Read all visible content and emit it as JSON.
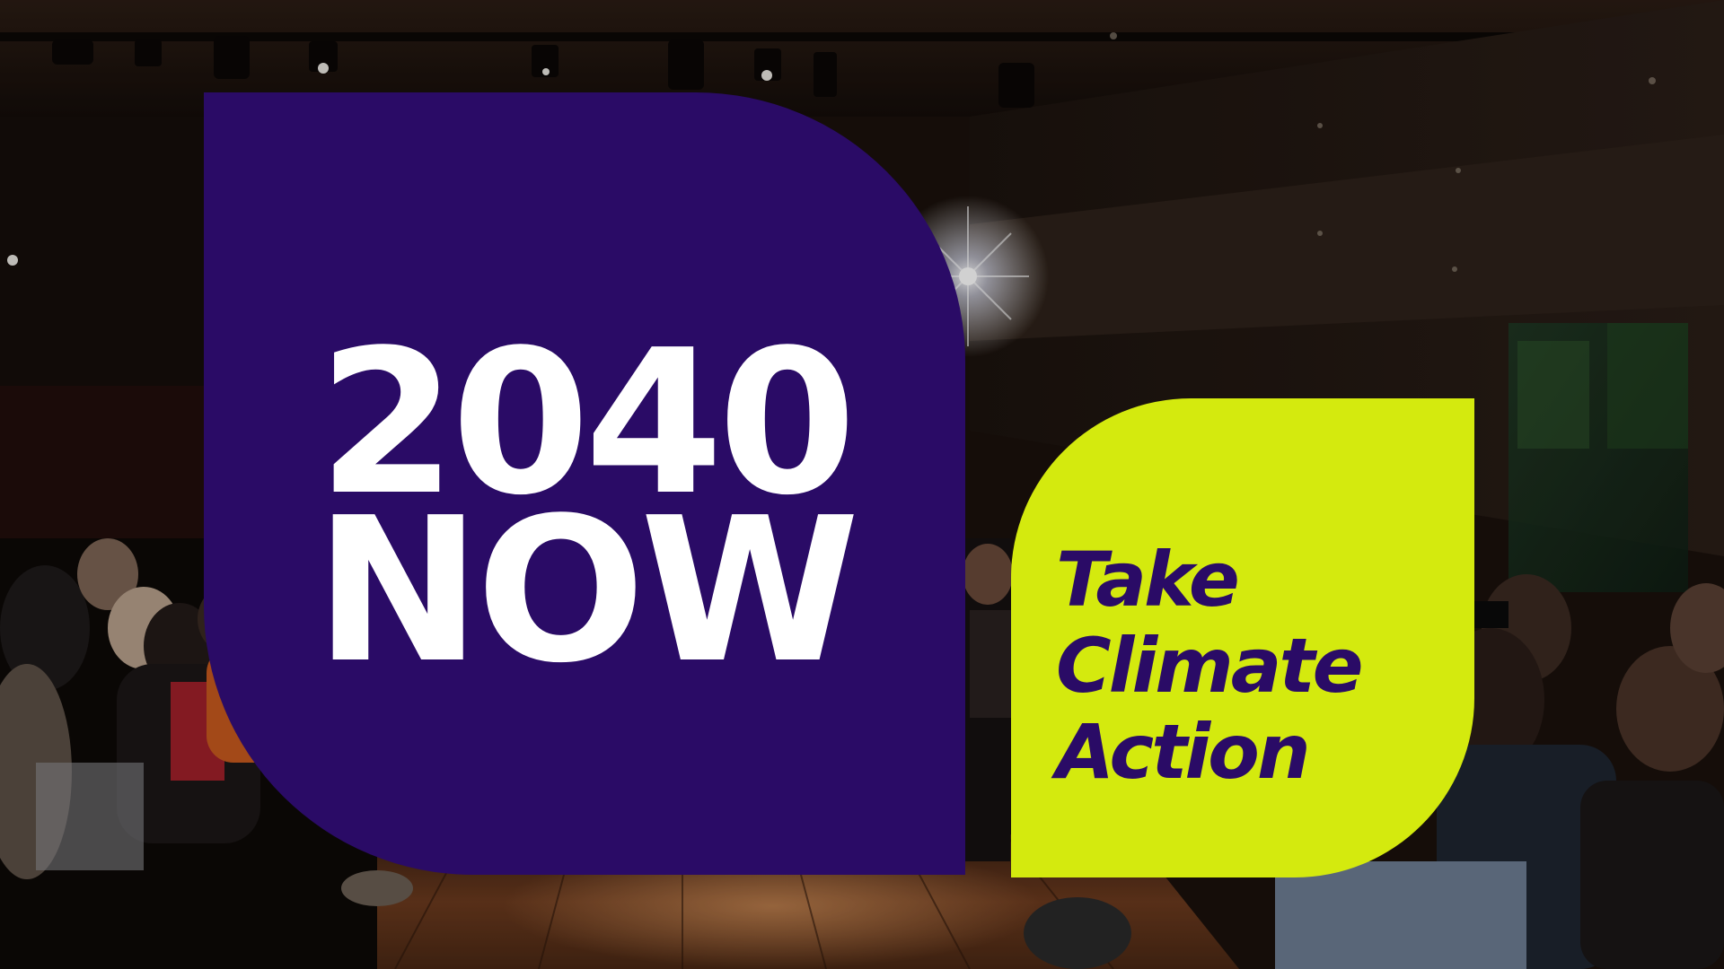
{
  "background": {
    "description_icon": "auditorium-photo"
  },
  "logo": {
    "line1": "2040",
    "line2": "NOW"
  },
  "tagline": {
    "line1": "Take",
    "line2": "Climate",
    "line3": "Action"
  },
  "colors": {
    "purple": "#2a0b66",
    "lime": "#d4ea0e",
    "white": "#ffffff"
  }
}
